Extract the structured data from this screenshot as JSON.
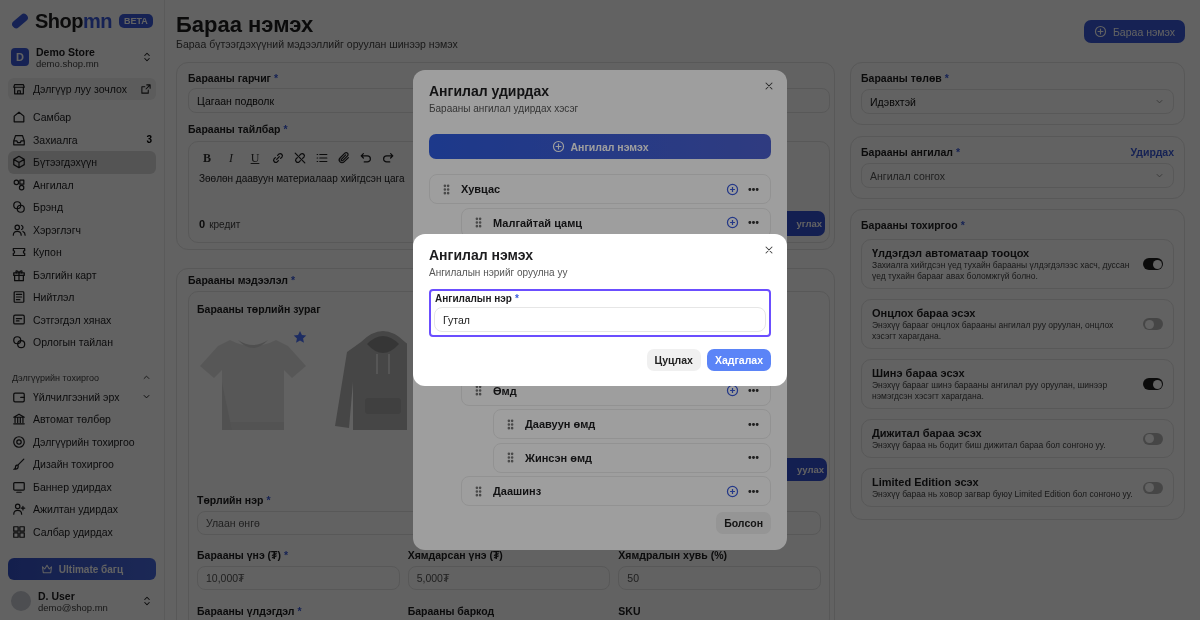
{
  "sidebar": {
    "brand": "Shop",
    "brand_accent": "mn",
    "badge": "BETA",
    "store": {
      "initial": "D",
      "name": "Demo Store",
      "domain": "demo.shop.mn"
    },
    "visit_link": "Дэлгүүр луу зочлох",
    "items": [
      {
        "label": "Самбар",
        "selected": false
      },
      {
        "label": "Захиалга",
        "selected": false,
        "count": "3"
      },
      {
        "label": "Бүтээгдэхүүн",
        "selected": true
      },
      {
        "label": "Ангилал",
        "selected": false
      },
      {
        "label": "Брэнд",
        "selected": false
      },
      {
        "label": "Хэрэглэгч",
        "selected": false
      },
      {
        "label": "Купон",
        "selected": false
      },
      {
        "label": "Бэлгийн карт",
        "selected": false
      },
      {
        "label": "Нийтлэл",
        "selected": false
      },
      {
        "label": "Сэтгэгдэл хянах",
        "selected": false
      },
      {
        "label": "Орлогын тайлан",
        "selected": false
      }
    ],
    "section": {
      "title": "Дэлгүүрийн тохиргоо",
      "expanded": true,
      "items": [
        {
          "label": "Үйлчилгээний эрх",
          "expanded": false
        },
        {
          "label": "Автомат төлбөр"
        },
        {
          "label": "Дэлгүүрийн тохиргоо"
        },
        {
          "label": "Дизайн тохиргоо"
        },
        {
          "label": "Баннер удирдах"
        },
        {
          "label": "Ажилтан удирдах"
        },
        {
          "label": "Салбар удирдах"
        }
      ]
    },
    "upgrade_button": "Ultimate багц",
    "user": {
      "name": "D. User",
      "email": "demo@shop.mn"
    }
  },
  "header": {
    "title": "Бараа нэмэх",
    "subtitle": "Бараа бүтээгдэхүүний мэдээллийг оруулан шинээр нэмэх",
    "add_button": "Бараа нэмэх"
  },
  "details": {
    "title_field": {
      "label": "Барааны гарчиг",
      "required_mark": "*",
      "value": "Цагаан подволк"
    },
    "description": {
      "label": "Барааны тайлбар",
      "required_mark": "*",
      "format_buttons": [
        {
          "label": "B"
        },
        {
          "label": "I"
        },
        {
          "label": "U"
        }
      ],
      "text": "Зөөлөн даавуун материалаар хийгдсэн цага",
      "credits": "0",
      "credits_unit": "кредит",
      "action_button": "углах"
    }
  },
  "info": {
    "label": "Барааны мэдээлэл",
    "required_mark": "*",
    "images_label": "Барааны төрлийн зураг",
    "images": [
      {
        "kind": "picture",
        "primary": true
      },
      {
        "kind": "picture",
        "primary": false
      }
    ],
    "action_button": "уулах",
    "variant_name": {
      "label": "Төрлийн нэр",
      "required_mark": "*",
      "placeholder": "Улаан өнгө"
    },
    "prices": [
      {
        "label": "Барааны үнэ (₮)",
        "required_mark": "*",
        "placeholder": "10,000₮"
      },
      {
        "label": "Хямдарсан үнэ (₮)",
        "placeholder": "5,000₮"
      },
      {
        "label": "Хямдралын хувь (%)",
        "placeholder": "50"
      }
    ],
    "stock_labels": [
      {
        "label": "Барааны үлдэгдэл",
        "required_mark": "*"
      },
      {
        "label": "Барааны баркод"
      },
      {
        "label": "SKU"
      }
    ]
  },
  "status": {
    "label": "Барааны төлөв",
    "required_mark": "*",
    "value": "Идэвхтэй"
  },
  "category": {
    "label": "Барааны ангилал",
    "required_mark": "*",
    "link": "Удирдах",
    "placeholder": "Ангилал сонгох"
  },
  "settings": {
    "label": "Барааны тохиргоо",
    "required_mark": "*",
    "options": [
      {
        "title": "Үлдэгдэл автоматаар тооцох",
        "description": "Захиалга хийгдсэн үед тухайн барааны үлдэгдэлээс хасч, дуссан үед тухайн барааг авах боломжгүй болно.",
        "on": true
      },
      {
        "title": "Онцлох бараа эсэх",
        "description": "Энэхүү барааг онцлох барааны ангилал руу оруулан, онцлох хэсэгт харагдана.",
        "on": false
      },
      {
        "title": "Шинэ бараа эсэх",
        "description": "Энэхүү барааг шинэ барааны ангилал руу оруулан, шинээр нэмэгдсэн хэсэгт харагдана.",
        "on": true
      },
      {
        "title": "Дижитал бараа эсэх",
        "description": "Энэхүү бараа нь бодит биш дижитал бараа бол сонгоно уу.",
        "on": false
      },
      {
        "title": "Limited Edition эсэх",
        "description": "Энэхүү бараа нь ховор загвар буюу Limited Edition бол сонгоно уу.",
        "on": false
      }
    ]
  },
  "manage_dialog": {
    "title": "Ангилал удирдах",
    "subtitle": "Барааны ангилал удирдах хэсэг",
    "add_button": "Ангилал нэмэх",
    "done_button": "Болсон",
    "tree": [
      {
        "name": "Хувцас",
        "can_add": true,
        "children": [
          {
            "name": "Малгайтай цамц",
            "can_add": true
          },
          {
            "name": "Өмд",
            "can_add": true,
            "children": [
              {
                "name": "Даавуун өмд",
                "can_add": false
              },
              {
                "name": "Жинсэн өмд",
                "can_add": false
              }
            ]
          },
          {
            "name": "Даашинз",
            "can_add": true
          }
        ]
      }
    ]
  },
  "add_dialog": {
    "title": "Ангилал нэмэх",
    "subtitle": "Ангилалын нэрийг оруулна уу",
    "field_label": "Ангилалын нэр",
    "required_mark": "*",
    "value": "Гутал",
    "focused": true,
    "cancel_button": "Цуцлах",
    "save_button": "Хадгалах"
  }
}
